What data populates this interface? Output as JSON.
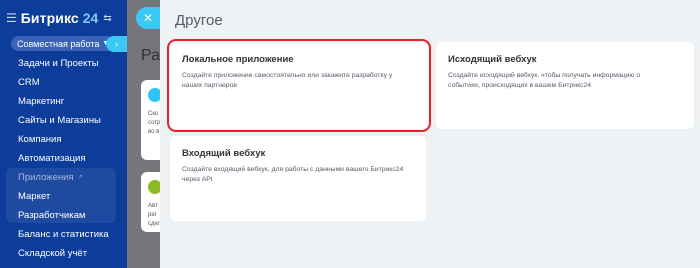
{
  "sidebar": {
    "brand_name": "Битрикс",
    "brand_number": "24",
    "group": "Совместная работа",
    "items": [
      {
        "label": "Задачи и Проекты"
      },
      {
        "label": "CRM"
      },
      {
        "label": "Маркетинг"
      },
      {
        "label": "Сайты и Магазины"
      },
      {
        "label": "Компания"
      },
      {
        "label": "Автоматизация"
      },
      {
        "label": "Приложения"
      },
      {
        "label": "Маркет"
      },
      {
        "label": "Разработчикам"
      },
      {
        "label": "Баланс и статистика"
      },
      {
        "label": "Складской учёт"
      }
    ]
  },
  "background": {
    "heading": "Раз",
    "card1_text": "Ско\nсотр\nво в",
    "card2_text": "Авт\nрег\nсдел"
  },
  "panel": {
    "title": "Другое",
    "cards": [
      {
        "title": "Локальное приложение",
        "desc": "Создайте приложение самостоятельно или закажите разработку у наших партнеров"
      },
      {
        "title": "Исходящий вебхук",
        "desc": "Создайте исходящий вебхук, чтобы получать информацию о событиях, происходящих в вашем Битрикс24"
      },
      {
        "title": "Входящий вебхук",
        "desc": "Создайте входящий вебхук, для работы с данными вашего Битрикс24 через API"
      }
    ]
  },
  "colors": {
    "sidebar": "#0d3d9a",
    "accent": "#3bc8f5",
    "selection_outline": "#e3252b"
  }
}
